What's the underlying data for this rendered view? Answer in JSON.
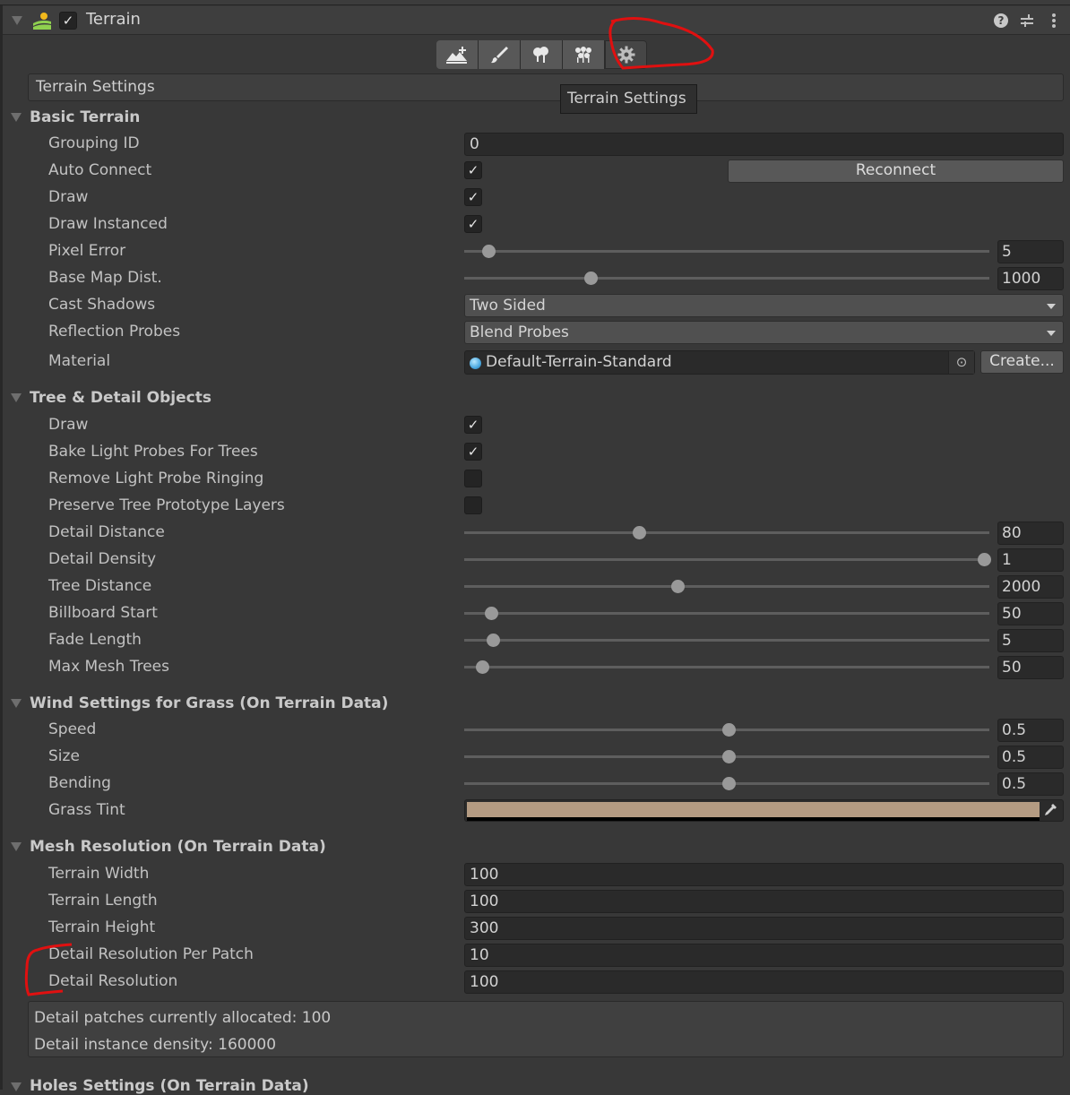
{
  "header": {
    "component_title": "Terrain",
    "enabled": true,
    "icons": [
      "terrain-icon",
      "help-icon",
      "presets-icon",
      "more-menu-icon"
    ]
  },
  "toolbar": {
    "tools": [
      {
        "name": "create-neighbor-terrains",
        "icon": "mountain-plus-icon"
      },
      {
        "name": "paint-terrain",
        "icon": "brush-icon"
      },
      {
        "name": "paint-trees",
        "icon": "trees-icon"
      },
      {
        "name": "paint-details",
        "icon": "details-icon"
      },
      {
        "name": "terrain-settings",
        "icon": "gear-icon",
        "active": true
      }
    ],
    "tooltip": "Terrain Settings"
  },
  "section_title": "Terrain Settings",
  "basic_terrain": {
    "heading": "Basic Terrain",
    "grouping_id": {
      "label": "Grouping ID",
      "value": "0"
    },
    "auto_connect": {
      "label": "Auto Connect",
      "checked": true,
      "button": "Reconnect"
    },
    "draw": {
      "label": "Draw",
      "checked": true
    },
    "draw_instanced": {
      "label": "Draw Instanced",
      "checked": true
    },
    "pixel_error": {
      "label": "Pixel Error",
      "value": "5",
      "fraction": 0.03
    },
    "base_map_dist": {
      "label": "Base Map Dist.",
      "value": "1000",
      "fraction": 0.23
    },
    "cast_shadows": {
      "label": "Cast Shadows",
      "selected": "Two Sided"
    },
    "reflection_probes": {
      "label": "Reflection Probes",
      "selected": "Blend Probes"
    },
    "material": {
      "label": "Material",
      "value": "Default-Terrain-Standard",
      "button": "Create..."
    }
  },
  "tree_detail": {
    "heading": "Tree & Detail Objects",
    "draw": {
      "label": "Draw",
      "checked": true
    },
    "bake_light_probes": {
      "label": "Bake Light Probes For Trees",
      "checked": true
    },
    "remove_ringing": {
      "label": "Remove Light Probe Ringing",
      "checked": false
    },
    "preserve_layers": {
      "label": "Preserve Tree Prototype Layers",
      "checked": false
    },
    "detail_distance": {
      "label": "Detail Distance",
      "value": "80",
      "fraction": 0.325
    },
    "detail_density": {
      "label": "Detail Density",
      "value": "1",
      "fraction": 1.0
    },
    "tree_distance": {
      "label": "Tree Distance",
      "value": "2000",
      "fraction": 0.4
    },
    "billboard_start": {
      "label": "Billboard Start",
      "value": "50",
      "fraction": 0.035
    },
    "fade_length": {
      "label": "Fade Length",
      "value": "5",
      "fraction": 0.038
    },
    "max_mesh_trees": {
      "label": "Max Mesh Trees",
      "value": "50",
      "fraction": 0.017
    }
  },
  "wind": {
    "heading": "Wind Settings for Grass (On Terrain Data)",
    "speed": {
      "label": "Speed",
      "value": "0.5",
      "fraction": 0.5
    },
    "size": {
      "label": "Size",
      "value": "0.5",
      "fraction": 0.5
    },
    "bending": {
      "label": "Bending",
      "value": "0.5",
      "fraction": 0.5
    },
    "grass_tint": {
      "label": "Grass Tint",
      "color": "#b49b82"
    }
  },
  "mesh_resolution": {
    "heading": "Mesh Resolution (On Terrain Data)",
    "terrain_width": {
      "label": "Terrain Width",
      "value": "100"
    },
    "terrain_length": {
      "label": "Terrain Length",
      "value": "100"
    },
    "terrain_height": {
      "label": "Terrain Height",
      "value": "300"
    },
    "detail_res_per_patch": {
      "label": "Detail Resolution Per Patch",
      "value": "10"
    },
    "detail_resolution": {
      "label": "Detail Resolution",
      "value": "100"
    },
    "info": {
      "patches": "Detail patches currently allocated: 100",
      "density": "Detail instance density: 160000"
    }
  },
  "holes": {
    "heading": "Holes Settings (On Terrain Data)"
  },
  "annotation_color": "#e01010"
}
